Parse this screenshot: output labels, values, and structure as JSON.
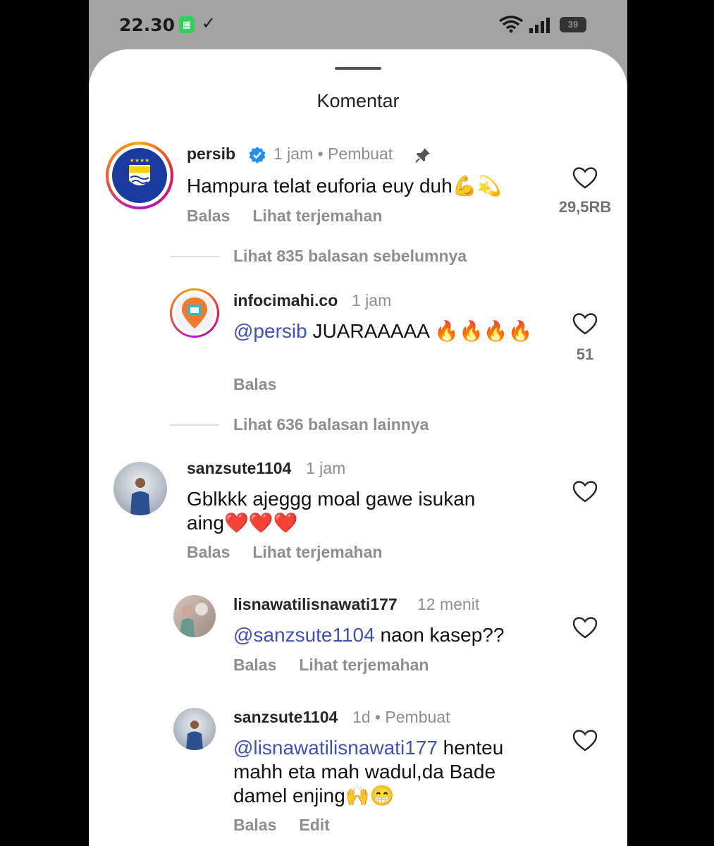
{
  "status_bar": {
    "time": "22.30",
    "battery": "39"
  },
  "sheet": {
    "title": "Komentar"
  },
  "comments": [
    {
      "username": "persib",
      "verified": true,
      "meta": "1 jam • Pembuat",
      "text": "Hampura telat euforia euy duh💪💫",
      "actions": [
        "Balas",
        "Lihat terjemahan"
      ],
      "likes": "29,5RB"
    },
    {
      "more_replies": "Lihat 835 balasan sebelumnya"
    },
    {
      "username": "infocimahi.co",
      "meta": "1 jam",
      "mention": "@persib",
      "text": " JUARAAAAA 🔥🔥🔥🔥",
      "actions": [
        "Balas"
      ],
      "likes": "51"
    },
    {
      "more_replies": "Lihat 636 balasan lainnya"
    },
    {
      "username": "sanzsute1104",
      "meta": "1 jam",
      "text": "Gblkkk ajeggg moal gawe isukan aing❤️❤️❤️",
      "actions": [
        "Balas",
        "Lihat terjemahan"
      ]
    },
    {
      "username": "lisnawatilisnawati177",
      "meta": "12 menit",
      "mention": "@sanzsute1104",
      "text": " naon kasep??",
      "actions": [
        "Balas",
        "Lihat terjemahan"
      ]
    },
    {
      "username": "sanzsute1104",
      "meta": "1d • Pembuat",
      "mention": "@lisnawatilisnawati177",
      "text": " henteu mahh eta mah wadul,da Bade damel enjing🙌😁",
      "actions": [
        "Balas",
        "Edit"
      ]
    }
  ],
  "colors": {
    "mention": "#3f51b5",
    "muted": "#8e8e8e",
    "verified": "#1f8ef1"
  }
}
